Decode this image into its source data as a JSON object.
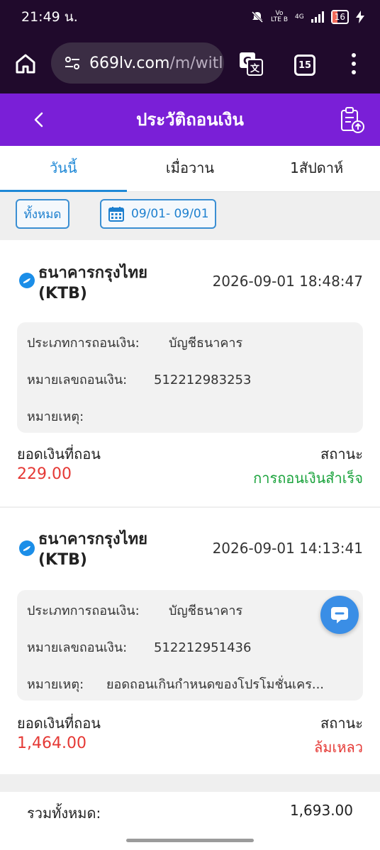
{
  "status_bar": {
    "time": "21:49 น.",
    "volte": "Vo\nLTE B",
    "network": "4G",
    "battery": "16"
  },
  "browser": {
    "url_host": "669lv.com",
    "url_path": "/m/witl",
    "tab_count": "15"
  },
  "header": {
    "title": "ประวัติถอนเงิน"
  },
  "tabs": [
    {
      "label": "วันนี้",
      "active": true
    },
    {
      "label": "เมื่อวาน",
      "active": false
    },
    {
      "label": "1สัปดาห์",
      "active": false
    }
  ],
  "filters": {
    "all_label": "ทั้งหมด",
    "date_range": "09/01- 09/01"
  },
  "records": [
    {
      "bank_line1": "ธนาคารกรุงไทย",
      "bank_line2": "(KTB)",
      "time": "2026-09-01 18:48:47",
      "type_label": "ประเภทการถอนเงิน:",
      "type_value": "บัญชีธนาคาร",
      "number_label": "หมายเลขถอนเงิน:",
      "number_value": "512212983253",
      "note_label": "หมายเหตุ:",
      "note_value": "",
      "amount_label": "ยอดเงินที่ถอน",
      "amount": "229.00",
      "status_label": "สถานะ",
      "status": "การถอนเงินสำเร็จ"
    },
    {
      "bank_line1": "ธนาคารกรุงไทย",
      "bank_line2": "(KTB)",
      "time": "2026-09-01 14:13:41",
      "type_label": "ประเภทการถอนเงิน:",
      "type_value": "บัญชีธนาคาร",
      "number_label": "หมายเลขถอนเงิน:",
      "number_value": "512212951436",
      "note_label": "หมายเหตุ:",
      "note_value": "ยอดถอนเกินกำหนดของโปรโมชั่นเคร...",
      "amount_label": "ยอดเงินที่ถอน",
      "amount": "1,464.00",
      "status_label": "สถานะ",
      "status": "ล้มเหลว"
    }
  ],
  "total": {
    "label": "รวมทั้งหมด:",
    "value": "1,693.00"
  },
  "colors": {
    "header_purple": "#7a1fd7",
    "browser_dark": "#200a2c",
    "tab_active_blue": "#1e88d6",
    "amount_red": "#e53935",
    "status_success_green": "#1aa33c",
    "status_fail_red": "#e53935"
  },
  "icons": {
    "home": "home-icon",
    "site_settings": "tune-icon",
    "translate": "translate-icon",
    "menu": "more-vert-icon",
    "back": "chevron-left-icon",
    "clipboard": "clipboard-upload-icon",
    "calendar": "calendar-icon",
    "bank": "bank-logo-icon",
    "chat": "chat-bubble-icon"
  }
}
